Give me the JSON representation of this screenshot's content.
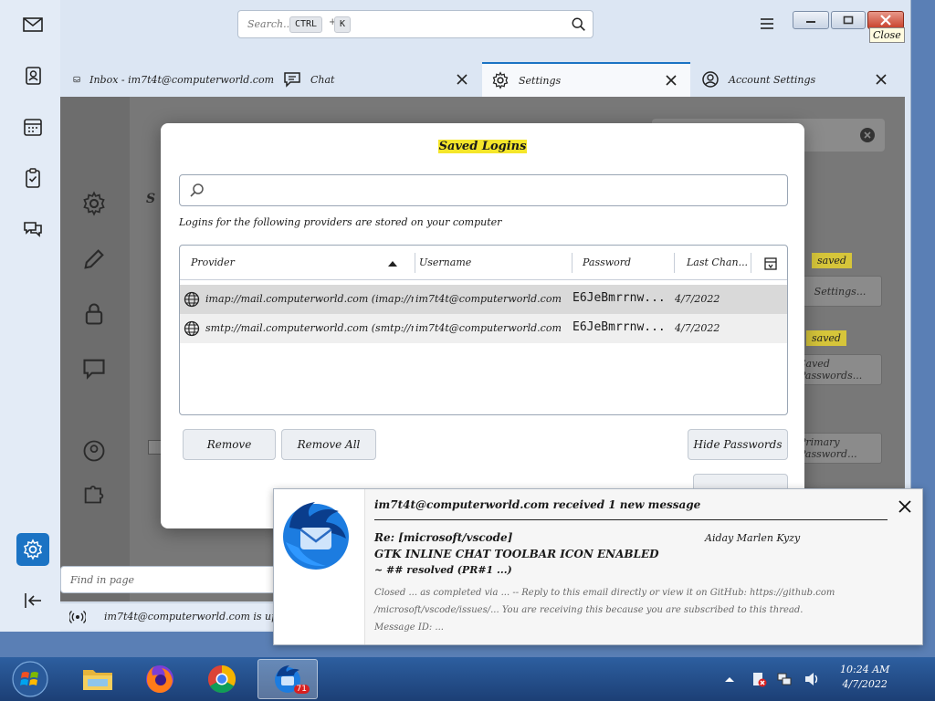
{
  "topbar": {
    "search_placeholder": "Search...",
    "kbd_ctrl": "CTRL",
    "kbd_sep": "+",
    "kbd_k": "K",
    "close_tooltip": "Close"
  },
  "tabs": [
    {
      "label": "Inbox - im7t4t@computerworld.com"
    },
    {
      "label": "Chat"
    },
    {
      "label": "Settings"
    },
    {
      "label": "Account Settings"
    }
  ],
  "background": {
    "saved_tag_1": "saved",
    "saved_tag_2": "saved",
    "settings_btn": "Settings...",
    "saved_passwords_btn": "Saved Passwords...",
    "show_passwords_btn": "Primary Password...",
    "heading_char": "S"
  },
  "find_bar": {
    "placeholder": "Find in page"
  },
  "status": {
    "text": "im7t4t@computerworld.com is up to date"
  },
  "dialog": {
    "title": "Saved Logins",
    "description": "Logins for the following providers are stored on your computer",
    "columns": {
      "provider": "Provider",
      "username": "Username",
      "password": "Password",
      "last_changed": "Last Chan..."
    },
    "rows": [
      {
        "provider": "imap://mail.computerworld.com (imap://mail.comput...",
        "username": "im7t4t@computerworld.com",
        "password": "E6JeBmrrnw...",
        "last_changed": "4/7/2022"
      },
      {
        "provider": "smtp://mail.computerworld.com (smtp://mail.comput...",
        "username": "im7t4t@computerworld.com",
        "password": "E6JeBmrrnw...",
        "last_changed": "4/7/2022"
      }
    ],
    "buttons": {
      "remove": "Remove",
      "remove_all": "Remove All",
      "hide_passwords": "Hide Passwords"
    }
  },
  "notification": {
    "title": "im7t4t@computerworld.com received 1 new message",
    "subject": "Re: [microsoft/vscode]",
    "sender": "Aiday Marlen Kyzy",
    "line2": "GTK INLINE CHAT TOOLBAR ICON ENABLED",
    "line3": "~ ## resolved (PR#1 ...)",
    "body1": "Closed ... as completed via ... -- Reply to this email directly or view it on GitHub: https://github.com",
    "body2": "/microsoft/vscode/issues/... You are receiving this because you are subscribed to this thread.",
    "body3": "Message ID: ..."
  },
  "taskbar": {
    "badge": "71",
    "clock_time": "10:24 AM",
    "clock_date": "4/7/2022"
  },
  "colors": {
    "accent": "#1b73c4",
    "highlight": "#f5e62a"
  }
}
